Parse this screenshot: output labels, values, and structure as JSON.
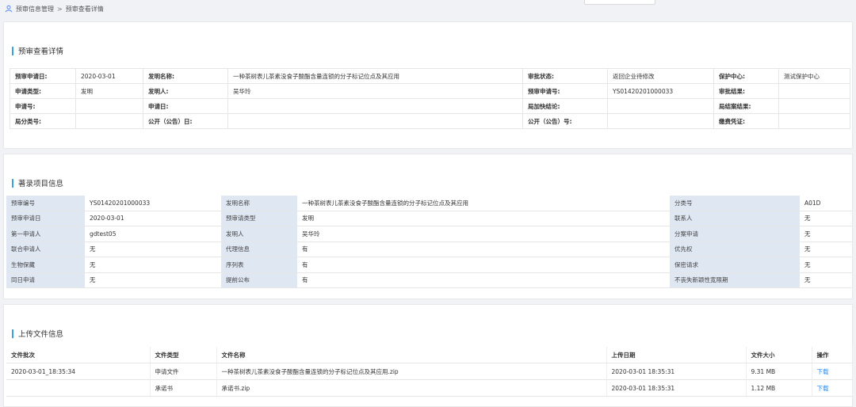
{
  "breadcrumb": {
    "parent": "预审信息管理",
    "separator": ">",
    "current": "预审查看详情"
  },
  "detail": {
    "title": "预审查看详情",
    "rows": [
      [
        {
          "label": "预审申请日:",
          "value": "2020-03-01"
        },
        {
          "label": "发明名称:",
          "value": "一种茶树表儿茶素没食子酸酯含量连锁的分子标记位点及其应用"
        },
        {
          "label": "审批状态:",
          "value": "返回企业待修改"
        },
        {
          "label": "保护中心:",
          "value": "测试保护中心"
        }
      ],
      [
        {
          "label": "申请类型:",
          "value": "发明"
        },
        {
          "label": "发明人:",
          "value": "吴华玲"
        },
        {
          "label": "预审申请号:",
          "value": "YS01420201000033"
        },
        {
          "label": "审批结果:",
          "value": ""
        }
      ],
      [
        {
          "label": "申请号:",
          "value": ""
        },
        {
          "label": "申请日:",
          "value": ""
        },
        {
          "label": "局加快结论:",
          "value": ""
        },
        {
          "label": "局结案结果:",
          "value": ""
        }
      ],
      [
        {
          "label": "局分类号:",
          "value": ""
        },
        {
          "label": "公开（公告）日:",
          "value": ""
        },
        {
          "label": "公开（公告）号:",
          "value": ""
        },
        {
          "label": "缴费凭证:",
          "value": ""
        }
      ]
    ]
  },
  "items": {
    "title": "著录项目信息",
    "rows": [
      [
        {
          "label": "预审编号",
          "value": "YS01420201000033"
        },
        {
          "label": "发明名称",
          "value": "一种茶树表儿茶素没食子酸酯含量连锁的分子标记位点及其应用"
        },
        {
          "label": "分类号",
          "value": "A01D"
        }
      ],
      [
        {
          "label": "预审申请日",
          "value": "2020-03-01"
        },
        {
          "label": "预审请类型",
          "value": "发明"
        },
        {
          "label": "联系人",
          "value": "无"
        }
      ],
      [
        {
          "label": "第一申请人",
          "value": "gdtest05"
        },
        {
          "label": "发明人",
          "value": "吴华玲"
        },
        {
          "label": "分案申请",
          "value": "无"
        }
      ],
      [
        {
          "label": "联合申请人",
          "value": "无"
        },
        {
          "label": "代理信息",
          "value": "有"
        },
        {
          "label": "优先权",
          "value": "无"
        }
      ],
      [
        {
          "label": "生物保藏",
          "value": "无"
        },
        {
          "label": "序列表",
          "value": "有"
        },
        {
          "label": "保密请求",
          "value": "无"
        }
      ],
      [
        {
          "label": "同日申请",
          "value": "无"
        },
        {
          "label": "提前公布",
          "value": "有"
        },
        {
          "label": "不丧失新颖性宽限期",
          "value": "无"
        }
      ]
    ]
  },
  "files": {
    "title": "上传文件信息",
    "headers": [
      "文件批次",
      "文件类型",
      "文件名称",
      "上传日期",
      "文件大小",
      "操作"
    ],
    "rows": [
      {
        "batch": "2020-03-01_18:35:34",
        "type": "申请文件",
        "name": "一种茶树表儿茶素没食子酸酯含量连锁的分子标记位点及其应用.zip",
        "date": "2020-03-01 18:35:31",
        "size": "9.31 MB",
        "action": "下载"
      },
      {
        "batch": "",
        "type": "承诺书",
        "name": "承诺书.zip",
        "date": "2020-03-01 18:35:31",
        "size": "1.12 MB",
        "action": "下载"
      }
    ]
  },
  "colors": {
    "accent": "#3aa0e0",
    "label_bg": "#dfe7f3",
    "link": "#2d8cf0"
  }
}
